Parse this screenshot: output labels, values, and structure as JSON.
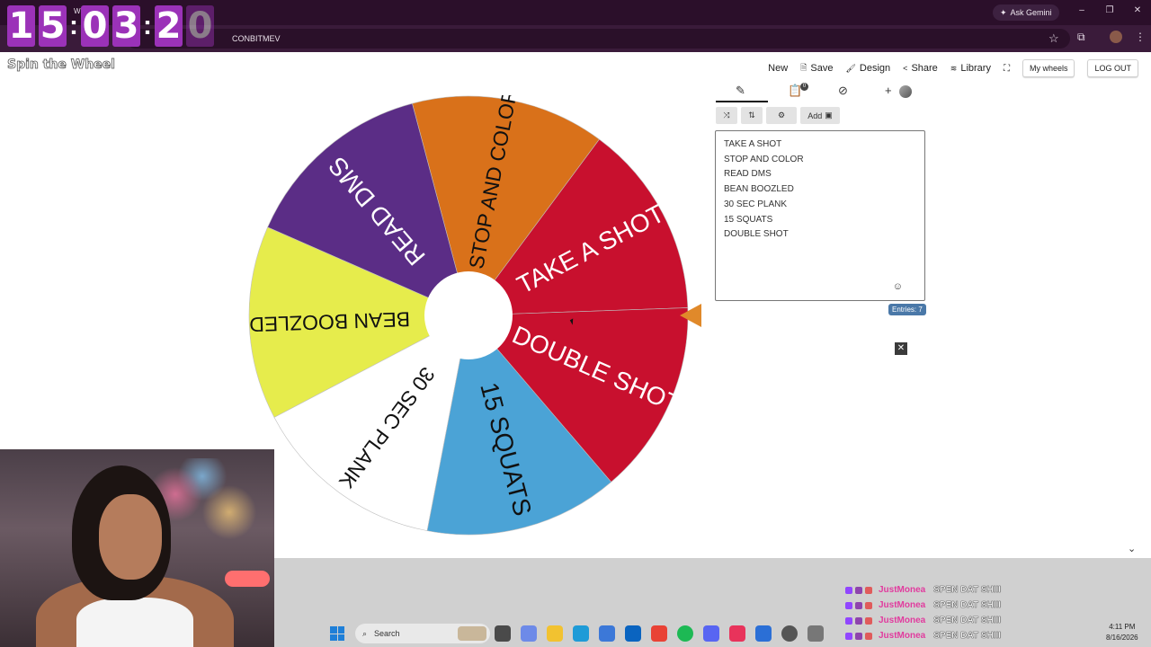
{
  "browser": {
    "tab_title": "Whee",
    "url_fragment": "CONBITMEV",
    "ask_gemini": "Ask Gemini"
  },
  "countdown": {
    "digits": [
      "1",
      "5",
      "0",
      "3",
      "2",
      "0"
    ]
  },
  "app": {
    "brand": "Spin the Wheel",
    "nav": {
      "new": "New",
      "save": "Save",
      "design": "Design",
      "share": "Share",
      "library": "Library",
      "my_wheels": "My wheels",
      "logout": "LOG OUT"
    }
  },
  "wheel": {
    "segments": [
      {
        "label": "TAKE A SHOT",
        "color": "#c8102e"
      },
      {
        "label": "STOP AND COLOR",
        "color": "#d9711a"
      },
      {
        "label": "READ DMS",
        "color": "#5b2d86"
      },
      {
        "label": "BEAN BOOZLED",
        "color": "#e6ec4c"
      },
      {
        "label": "30 SEC PLANK",
        "color": "#ffffff"
      },
      {
        "label": "15 SQUATS",
        "color": "#4ba3d6"
      },
      {
        "label": "DOUBLE SHOT",
        "color": "#c8102e"
      }
    ],
    "pointer_color": "#e0892a"
  },
  "panel": {
    "tab_badge": "0",
    "add_image_label": "Add",
    "entries": [
      "TAKE A SHOT",
      "STOP AND COLOR",
      "READ DMS",
      "BEAN BOOZLED",
      "30 SEC PLANK",
      "15 SQUATS",
      "DOUBLE SHOT"
    ],
    "entries_count": "Entries: 7"
  },
  "chat": {
    "messages": [
      {
        "user": "JustMonea",
        "text": "SPEN DAT SHIII"
      },
      {
        "user": "JustMonea",
        "text": "SPEN DAT SHIII"
      },
      {
        "user": "JustMonea",
        "text": "SPEN DAT SHIII"
      },
      {
        "user": "JustMonea",
        "text": "SPEN DAT SHIII"
      }
    ]
  },
  "taskbar": {
    "search_placeholder": "Search",
    "time": "4:11 PM",
    "date": "8/16/2026"
  }
}
